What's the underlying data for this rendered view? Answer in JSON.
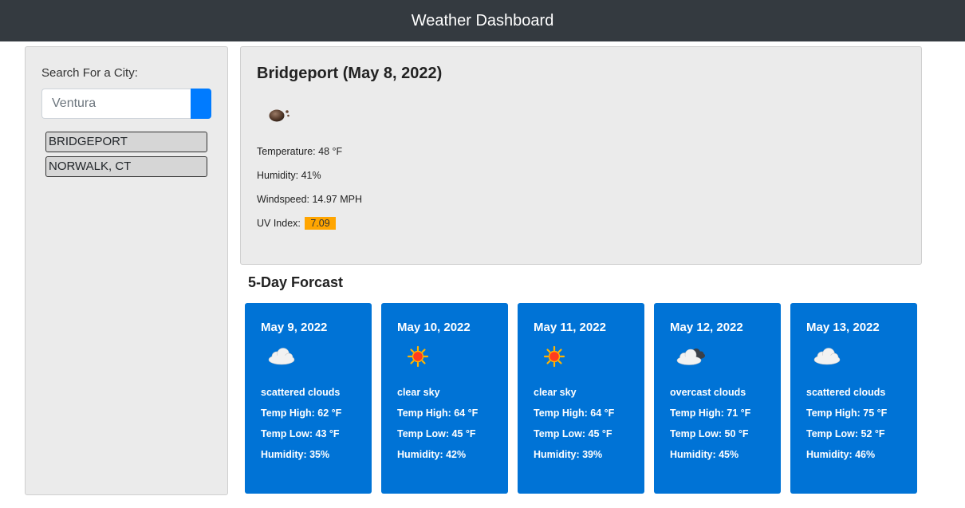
{
  "header": {
    "title": "Weather Dashboard"
  },
  "sidebar": {
    "search_label": "Search For a City:",
    "search_placeholder": "Ventura",
    "history": [
      "BRIDGEPORT",
      "NORWALK, CT"
    ]
  },
  "current": {
    "title": "Bridgeport (May 8, 2022)",
    "icon": "rain-cloud-icon",
    "temperature_label": "Temperature: 48 °F",
    "humidity_label": "Humidity: 41%",
    "windspeed_label": "Windspeed: 14.97 MPH",
    "uv_label": "UV Index:",
    "uv_value": "7.09",
    "uv_color": "#ffa500"
  },
  "forecast": {
    "heading": "5-Day Forcast",
    "card_color": "#0073d6",
    "days": [
      {
        "date": "May 9, 2022",
        "icon": "cloud-icon",
        "description": "scattered clouds",
        "high": "Temp High: 62 °F",
        "low": "Temp Low: 43 °F",
        "humidity": "Humidity: 35%"
      },
      {
        "date": "May 10, 2022",
        "icon": "sun-icon",
        "description": "clear sky",
        "high": "Temp High: 64 °F",
        "low": "Temp Low: 45 °F",
        "humidity": "Humidity: 42%"
      },
      {
        "date": "May 11, 2022",
        "icon": "sun-icon",
        "description": "clear sky",
        "high": "Temp High: 64 °F",
        "low": "Temp Low: 45 °F",
        "humidity": "Humidity: 39%"
      },
      {
        "date": "May 12, 2022",
        "icon": "overcast-clouds-icon",
        "description": "overcast clouds",
        "high": "Temp High: 71 °F",
        "low": "Temp Low: 50 °F",
        "humidity": "Humidity: 45%"
      },
      {
        "date": "May 13, 2022",
        "icon": "cloud-icon",
        "description": "scattered clouds",
        "high": "Temp High: 75 °F",
        "low": "Temp Low: 52 °F",
        "humidity": "Humidity: 46%"
      }
    ]
  }
}
